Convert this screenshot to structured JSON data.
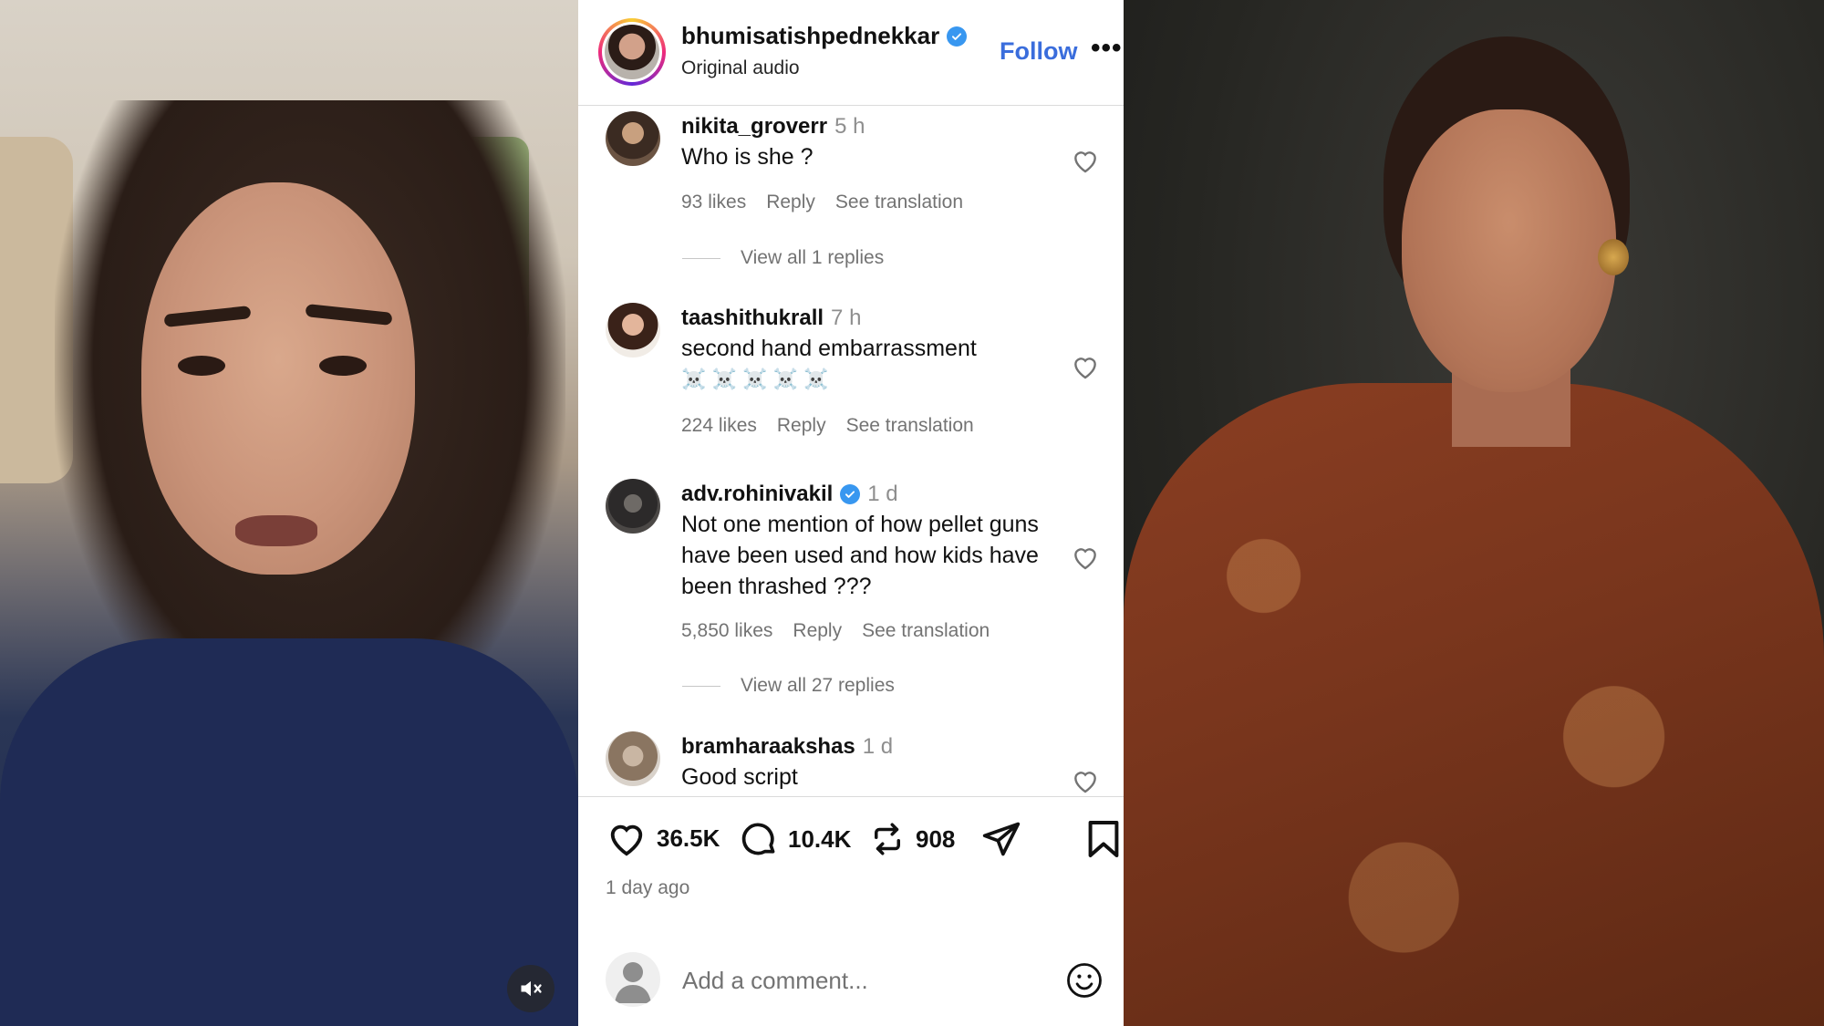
{
  "post": {
    "username": "bhumisatishpednekkar",
    "audio": "Original audio",
    "follow_label": "Follow",
    "more_label": "•••"
  },
  "comments": [
    {
      "username": "nikita_groverr",
      "time": "5 h",
      "verified": false,
      "text": "Who is she ?",
      "likes": "93 likes",
      "reply": "Reply",
      "translate": "See translation",
      "replies": "View all 1 replies"
    },
    {
      "username": "taashithukrall",
      "time": "7 h",
      "verified": false,
      "text": "second hand embarrassment",
      "emoji": "☠️ ☠️ ☠️ ☠️ ☠️",
      "likes": "224 likes",
      "reply": "Reply",
      "translate": "See translation"
    },
    {
      "username": "adv.rohinivakil",
      "time": "1 d",
      "verified": true,
      "text": "Not one mention of how pellet guns have been used and how kids have been thrashed ???",
      "likes": "5,850 likes",
      "reply": "Reply",
      "translate": "See translation",
      "replies": "View all 27 replies"
    },
    {
      "username": "bramharaakshas",
      "time": "1 d",
      "verified": false,
      "text": "Good script"
    }
  ],
  "actions": {
    "likes": "36.5K",
    "comments": "10.4K",
    "reposts": "908",
    "posted": "1 day ago"
  },
  "comment_input": {
    "placeholder": "Add a comment..."
  },
  "colors": {
    "follow": "#3a6ddc",
    "verified": "#3897f0",
    "muted_text": "#737373"
  }
}
